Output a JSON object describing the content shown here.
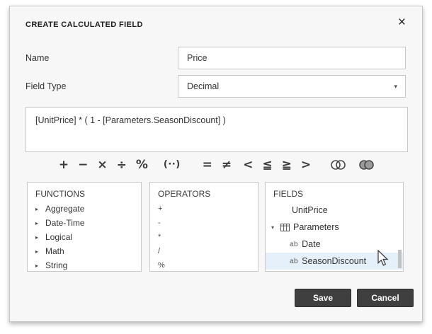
{
  "dialog": {
    "title": "CREATE CALCULATED FIELD",
    "close_glyph": "×"
  },
  "form": {
    "name_label": "Name",
    "name_value": "Price",
    "field_type_label": "Field Type",
    "field_type_value": "Decimal",
    "field_type_caret": "▾",
    "expression": "[UnitPrice] * ( 1 - [Parameters.SeasonDiscount] )"
  },
  "toolbar": {
    "operators": [
      {
        "name": "plus",
        "glyph": "+"
      },
      {
        "name": "minus",
        "glyph": "−"
      },
      {
        "name": "multiply",
        "glyph": "×"
      },
      {
        "name": "divide",
        "glyph": "÷"
      },
      {
        "name": "percent",
        "glyph": "%"
      },
      {
        "name": "parentheses",
        "glyph": "(··)"
      },
      {
        "name": "equal",
        "glyph": "="
      },
      {
        "name": "not-equal",
        "glyph": "≠"
      },
      {
        "name": "less-than",
        "glyph": "<"
      },
      {
        "name": "less-or-equal",
        "glyph": "≦"
      },
      {
        "name": "greater-or-equal",
        "glyph": "≧"
      },
      {
        "name": "greater-than",
        "glyph": ">"
      }
    ],
    "venn_icons": [
      "intersect-icon",
      "union-icon"
    ]
  },
  "functions": {
    "header": "FUNCTIONS",
    "expander_glyph": "▸",
    "items": [
      {
        "label": "Aggregate"
      },
      {
        "label": "Date-Time"
      },
      {
        "label": "Logical"
      },
      {
        "label": "Math"
      },
      {
        "label": "String"
      }
    ]
  },
  "operators_list": {
    "header": "OPERATORS",
    "items": [
      {
        "label": "+"
      },
      {
        "label": "-"
      },
      {
        "label": "*"
      },
      {
        "label": "/"
      },
      {
        "label": "%"
      }
    ]
  },
  "fields": {
    "header": "FIELDS",
    "items": [
      {
        "label": "UnitPrice"
      },
      {
        "label": "Parameters",
        "expander": "▾"
      },
      {
        "label": "Date",
        "type_icon": "ab"
      },
      {
        "label": "SeasonDiscount",
        "type_icon": "ab",
        "selected": true
      }
    ]
  },
  "buttons": {
    "save": "Save",
    "cancel": "Cancel"
  },
  "colors": {
    "dialog_bg": "#f7f7f7",
    "selection_bg": "#e6f0fa",
    "button_bg": "#3f3f3f",
    "border": "#c8c8c8",
    "text": "#333333"
  }
}
